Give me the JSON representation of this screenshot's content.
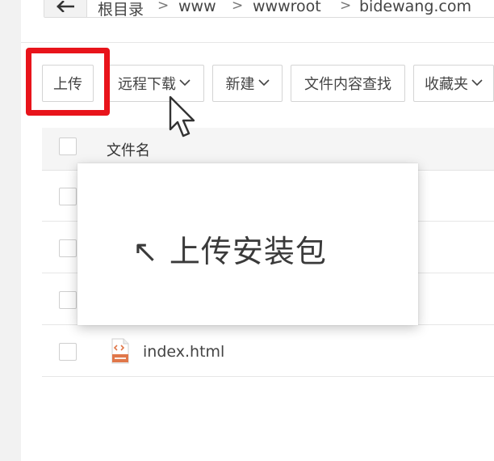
{
  "breadcrumb": {
    "items": [
      "根目录",
      "www",
      "wwwroot",
      "bidewang.com"
    ],
    "separator": ">"
  },
  "toolbar": {
    "upload": "上传",
    "remote_download": "远程下载",
    "new": "新建",
    "content_search": "文件内容查找",
    "favorites": "收藏夹"
  },
  "table": {
    "column_filename": "文件名",
    "files": [
      {
        "name": "index.html",
        "icon": "html-file-icon"
      }
    ]
  },
  "tooltip": {
    "text": "↖ 上传安装包"
  },
  "colors": {
    "highlight": "#e8141b",
    "html_icon": "#e0774a"
  }
}
